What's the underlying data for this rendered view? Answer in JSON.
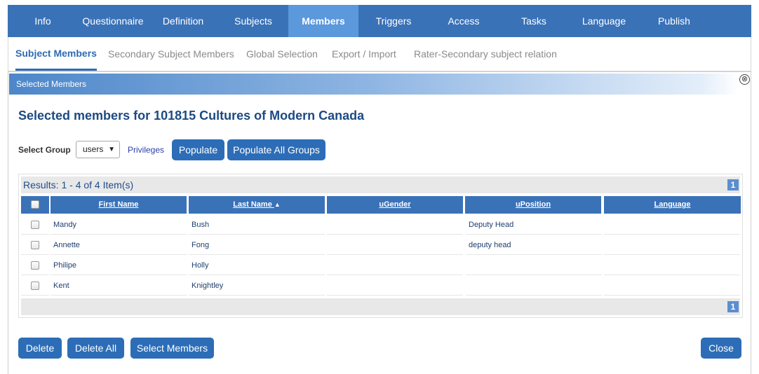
{
  "topnav": {
    "tabs": [
      {
        "label": "Info"
      },
      {
        "label": "Questionnaire"
      },
      {
        "label": "Definition"
      },
      {
        "label": "Subjects"
      },
      {
        "label": "Members",
        "active": true
      },
      {
        "label": "Triggers"
      },
      {
        "label": "Access"
      },
      {
        "label": "Tasks"
      },
      {
        "label": "Language"
      },
      {
        "label": "Publish"
      }
    ]
  },
  "subnav": {
    "tabs": [
      {
        "label": "Subject Members",
        "active": true
      },
      {
        "label": "Secondary Subject Members"
      },
      {
        "label": "Global Selection"
      },
      {
        "label": "Export / Import"
      },
      {
        "label": "Rater-Secondary subject relation"
      }
    ]
  },
  "panel": {
    "header": "Selected Members",
    "close_icon": "⊗",
    "heading": "Selected members for 101815 Cultures of Modern Canada"
  },
  "toolbar": {
    "select_group_label": "Select Group",
    "group_value": "users",
    "privileges_link": "Privileges",
    "populate_button": "Populate",
    "populate_all_button": "Populate All Groups"
  },
  "grid": {
    "results_text": "Results: 1 - 4 of 4 Item(s)",
    "page_number": "1",
    "columns": [
      "First Name",
      "Last Name",
      "uGender",
      "uPosition",
      "Language"
    ],
    "sort_indicator": "▲",
    "rows": [
      {
        "first": "Mandy",
        "last": "Bush",
        "gender": "",
        "position": "Deputy Head",
        "language": ""
      },
      {
        "first": "Annette",
        "last": "Fong",
        "gender": "",
        "position": "deputy head",
        "language": ""
      },
      {
        "first": "Philipe",
        "last": "Holly",
        "gender": "",
        "position": "",
        "language": ""
      },
      {
        "first": "Kent",
        "last": "Knightley",
        "gender": "",
        "position": "",
        "language": ""
      }
    ]
  },
  "actions": {
    "delete": "Delete",
    "delete_all": "Delete All",
    "select_members": "Select Members",
    "close": "Close"
  },
  "colors": {
    "nav_blue": "#3a72b8",
    "nav_active": "#5b98dc",
    "button_blue": "#2d6db7",
    "heading": "#1c4a82"
  }
}
